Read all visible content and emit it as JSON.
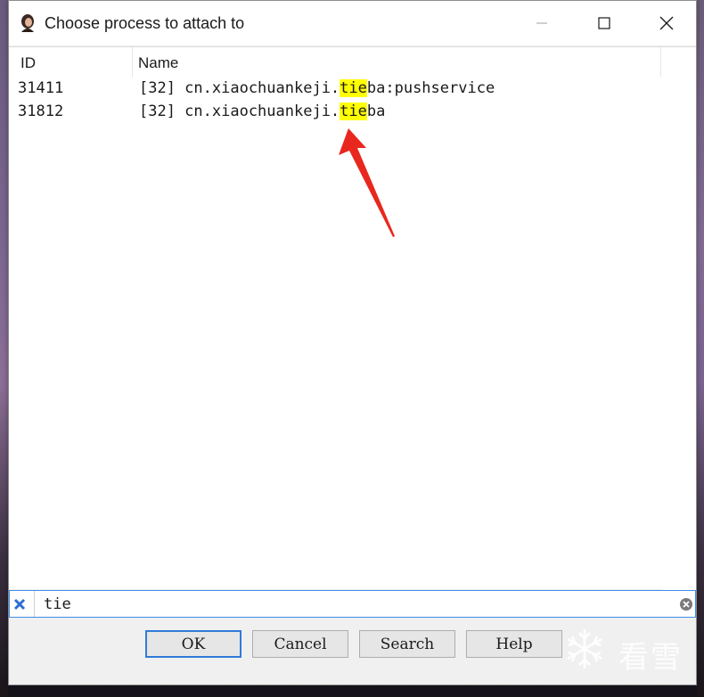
{
  "window": {
    "title": "Choose process to attach to"
  },
  "table": {
    "columns": [
      "ID",
      "Name"
    ],
    "rows": [
      {
        "id": "31411",
        "name_prefix": "[32] cn.xiaochuankeji.",
        "name_match": "tie",
        "name_suffix": "ba:pushservice"
      },
      {
        "id": "31812",
        "name_prefix": "[32] cn.xiaochuankeji.",
        "name_match": "tie",
        "name_suffix": "ba"
      }
    ]
  },
  "search": {
    "value": "tie"
  },
  "buttons": {
    "ok": "OK",
    "cancel": "Cancel",
    "search": "Search",
    "help": "Help"
  },
  "watermark": {
    "text": "看雪"
  },
  "colors": {
    "highlight": "#ffff00",
    "annotation_arrow": "#e8281e",
    "focus_border": "#2f7bd9"
  }
}
